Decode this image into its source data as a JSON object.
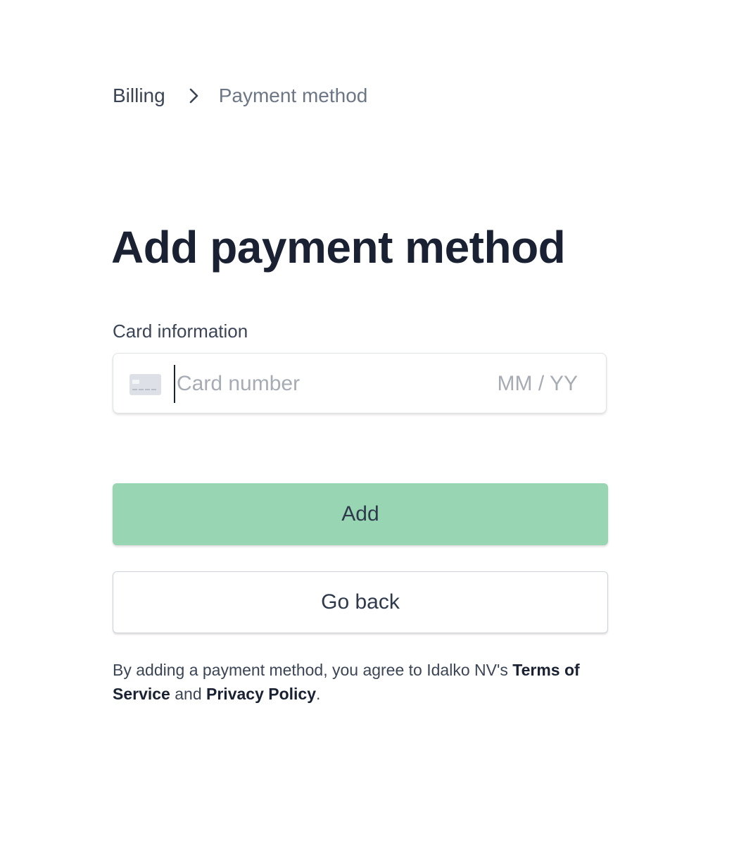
{
  "breadcrumb": {
    "root": "Billing",
    "current": "Payment method"
  },
  "page": {
    "title": "Add payment method"
  },
  "card_form": {
    "label": "Card information",
    "card_number_placeholder": "Card number",
    "card_number_value": "",
    "expiry_placeholder": "MM / YY",
    "expiry_value": "",
    "card_icon": "credit-card-icon"
  },
  "actions": {
    "add_label": "Add",
    "back_label": "Go back"
  },
  "legal": {
    "prefix": "By adding a payment method, you agree to Idalko NV's ",
    "terms_link": "Terms of Service",
    "middle": " and ",
    "privacy_link": "Privacy Policy",
    "suffix": "."
  },
  "colors": {
    "primary_button": "#98d6b3",
    "title": "#1a2133",
    "muted": "#6c7685"
  }
}
